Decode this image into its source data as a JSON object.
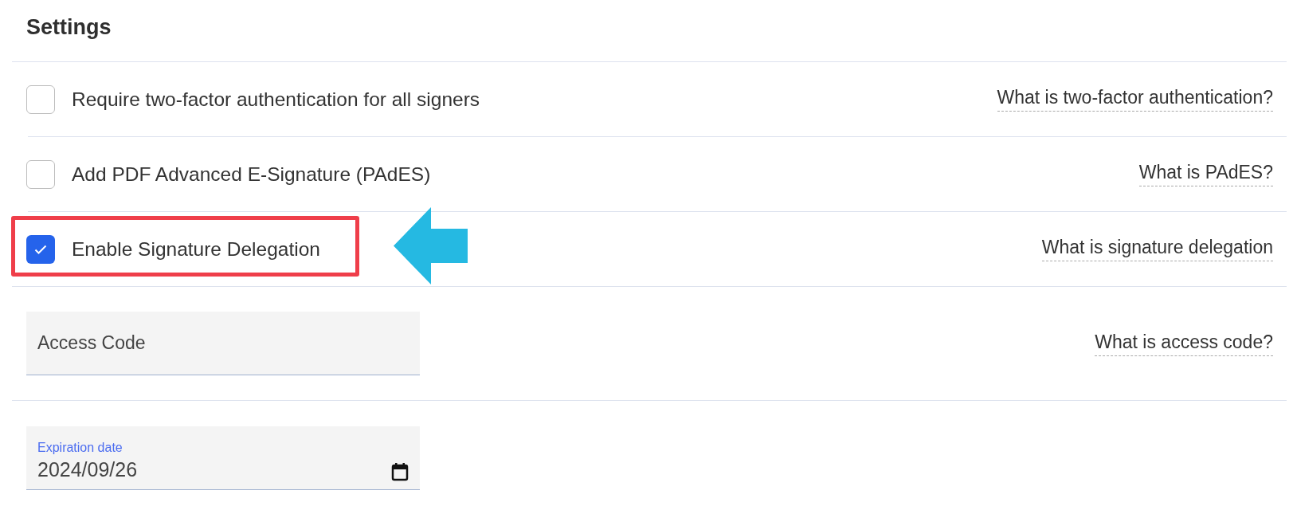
{
  "title": "Settings",
  "options": [
    {
      "label": "Require two-factor authentication for all signers",
      "checked": false,
      "highlighted": false,
      "help_link": "What is two-factor authentication?"
    },
    {
      "label": "Add PDF Advanced E-Signature (PAdES)",
      "checked": false,
      "highlighted": false,
      "help_link": "What is PAdES?"
    },
    {
      "label": "Enable Signature Delegation",
      "checked": true,
      "highlighted": true,
      "help_link": "What is signature delegation"
    }
  ],
  "access_code": {
    "placeholder": "Access Code",
    "help_link": "What is access code?"
  },
  "expiration": {
    "label": "Expiration date",
    "value": "2024/09/26"
  }
}
